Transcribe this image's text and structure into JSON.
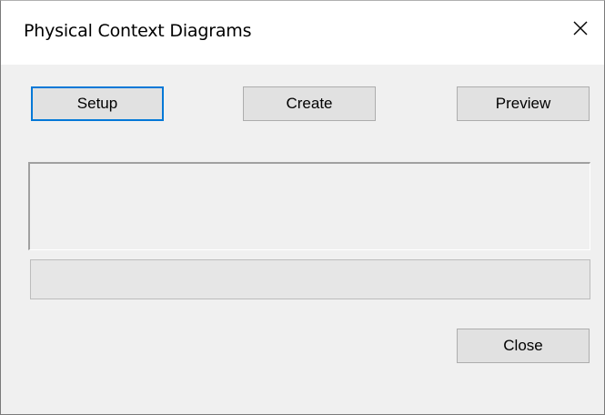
{
  "window": {
    "title": "Physical Context Diagrams"
  },
  "buttons": {
    "setup_label": "Setup",
    "create_label": "Create",
    "preview_label": "Preview",
    "close_label": "Close"
  },
  "progress": {
    "value": 0
  },
  "colors": {
    "focus_border": "#0078d7",
    "button_face": "#e1e1e1",
    "window_bg": "#f0f0f0"
  },
  "icons": {
    "close": "close-icon"
  }
}
